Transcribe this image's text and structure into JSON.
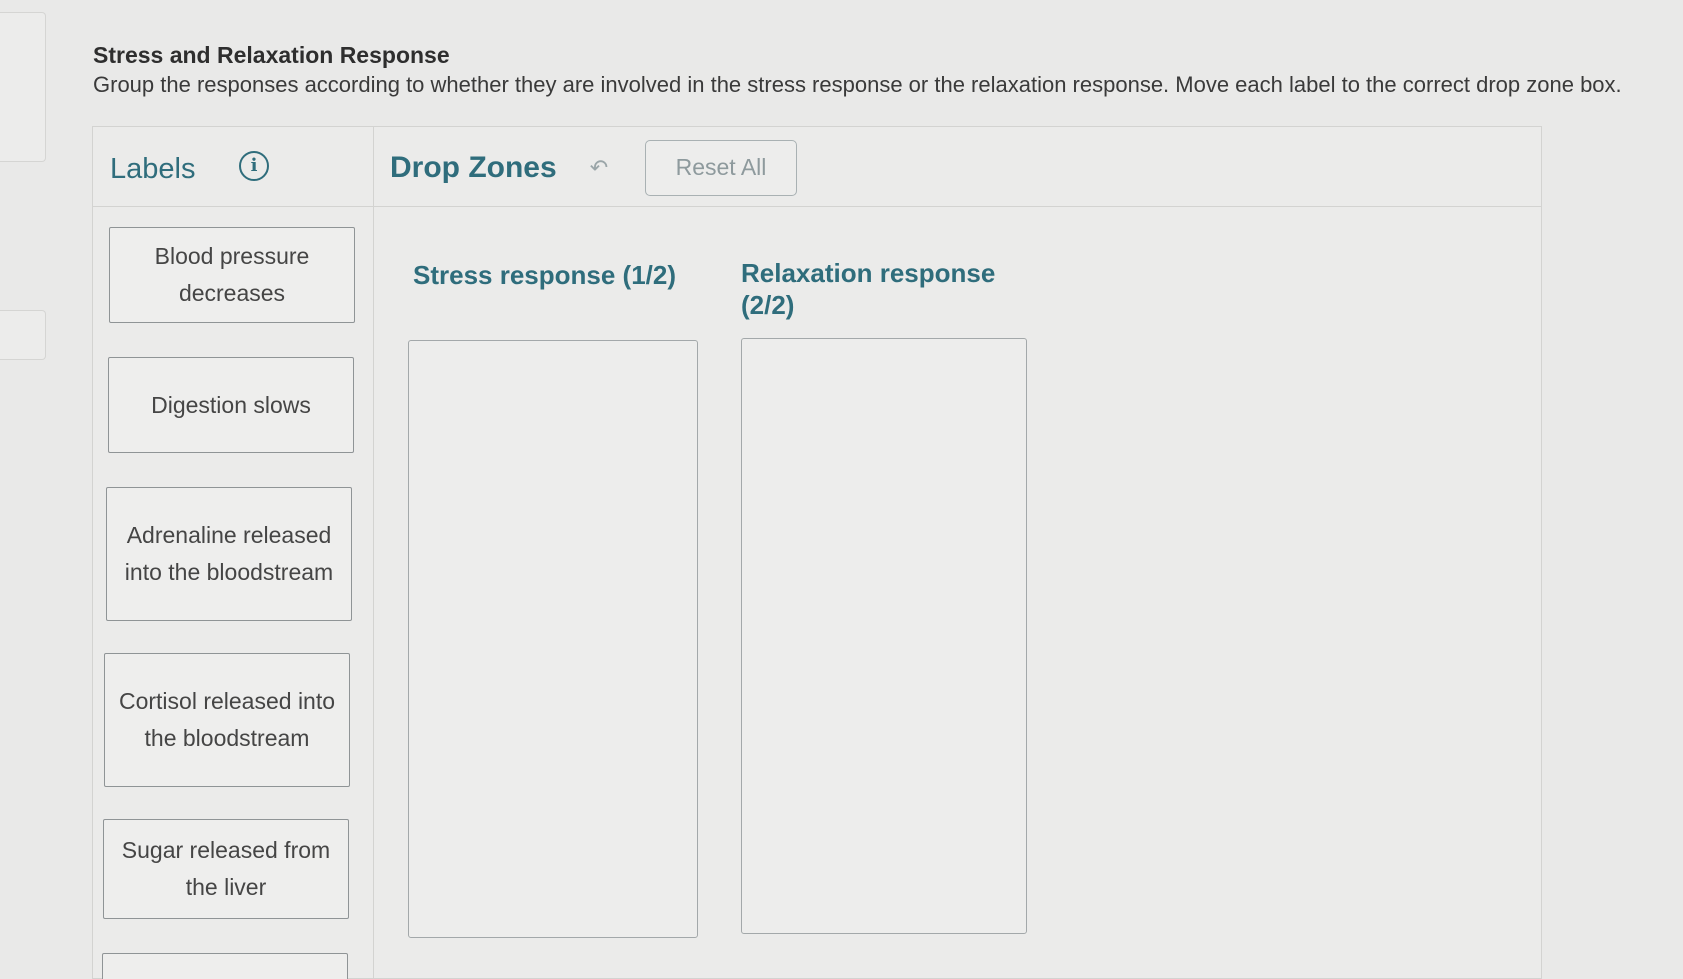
{
  "question": {
    "title": "Stress and Relaxation Response",
    "instructions": "Group the responses according to whether they are involved in the stress response or the relaxation response. Move each label to the correct drop zone box."
  },
  "header": {
    "labels_title": "Labels",
    "info_icon": "info-icon",
    "info_glyph": "i",
    "dropzones_title": "Drop Zones",
    "undo_icon": "undo-arrow-icon",
    "undo_glyph": "↶",
    "reset_label": "Reset All"
  },
  "labels": [
    {
      "text": "Blood pressure decreases"
    },
    {
      "text": "Digestion slows"
    },
    {
      "text": "Adrenaline released into the bloodstream"
    },
    {
      "text": "Cortisol released into the bloodstream"
    },
    {
      "text": "Sugar released from the liver"
    },
    {
      "text": ""
    }
  ],
  "zones": [
    {
      "title": "Stress response (1/2)"
    },
    {
      "title": "Relaxation response (2/2)"
    }
  ],
  "colors": {
    "accent": "#2f6d7c",
    "background": "#e9e9e8",
    "card_border": "#8f9496"
  }
}
